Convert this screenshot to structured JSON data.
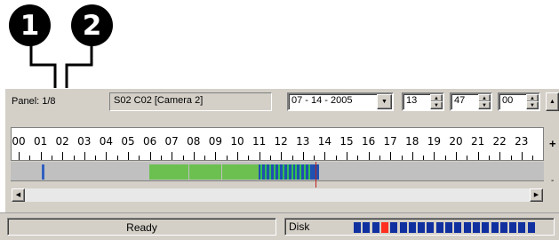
{
  "callouts": [
    "1",
    "2"
  ],
  "panel": {
    "label": "Panel: 1/8",
    "camera": "S02 C02 [Camera 2]",
    "date": "07 - 14 - 2005",
    "hour": "13",
    "minute": "47",
    "second": "00"
  },
  "timeline": {
    "hours": [
      "00",
      "01",
      "02",
      "03",
      "04",
      "05",
      "06",
      "07",
      "08",
      "09",
      "10",
      "11",
      "12",
      "13",
      "14",
      "15",
      "16",
      "17",
      "18",
      "19",
      "20",
      "21",
      "22",
      "23"
    ],
    "zoom_in_label": "+",
    "zoom_out_label": "-",
    "cursor_hour": 13.6,
    "segments": [
      {
        "start": 1.1,
        "end": 1.2,
        "color": "#3060c0"
      },
      {
        "start": 6.0,
        "end": 7.8,
        "color": "#6cc050"
      },
      {
        "start": 7.85,
        "end": 9.3,
        "color": "#6cc050"
      },
      {
        "start": 9.35,
        "end": 11.0,
        "color": "#6cc050"
      },
      {
        "start": 11.0,
        "end": 13.8,
        "color": "#2050b0"
      }
    ],
    "stripes": [
      11.1,
      11.3,
      11.5,
      11.7,
      11.9,
      12.1,
      12.3,
      12.5,
      12.7,
      12.9,
      13.1,
      13.3
    ]
  },
  "status": {
    "text": "Ready",
    "disk_label": "Disk",
    "disk_cells": 20,
    "disk_used_index": 3
  },
  "colors": {
    "disk_blue": "#1030a0",
    "disk_red": "#ff3020",
    "cursor": "#c02020"
  },
  "icons": {
    "dropdown": "triangle-down",
    "spin_up": "triangle-up",
    "spin_down": "triangle-down",
    "scroll_left": "triangle-left",
    "scroll_right": "triangle-right"
  }
}
